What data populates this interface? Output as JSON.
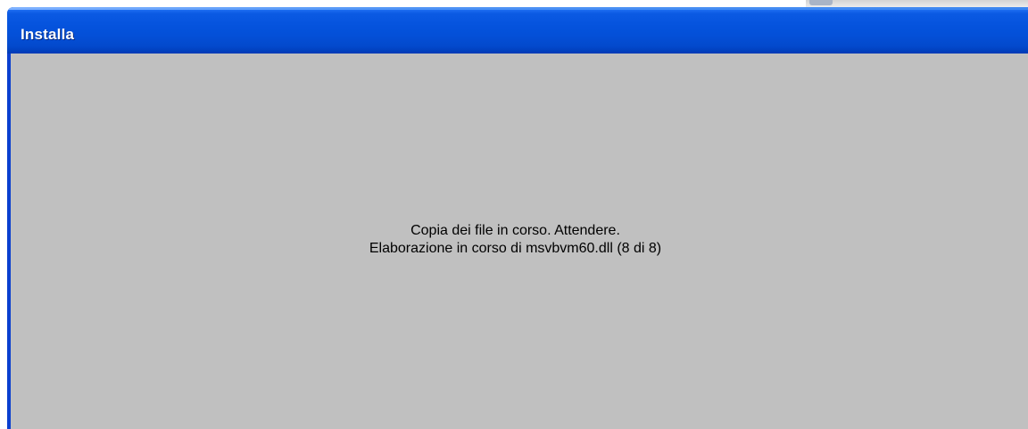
{
  "window": {
    "title": "Installa"
  },
  "progress": {
    "line1": "Copia dei file in corso. Attendere.",
    "line2": "Elaborazione in corso di msvbvm60.dll (8 di 8)"
  },
  "colors": {
    "titlebar": "#0553dd",
    "client_background": "#c0c0c0",
    "title_text": "#ffffff",
    "message_text": "#000000"
  }
}
